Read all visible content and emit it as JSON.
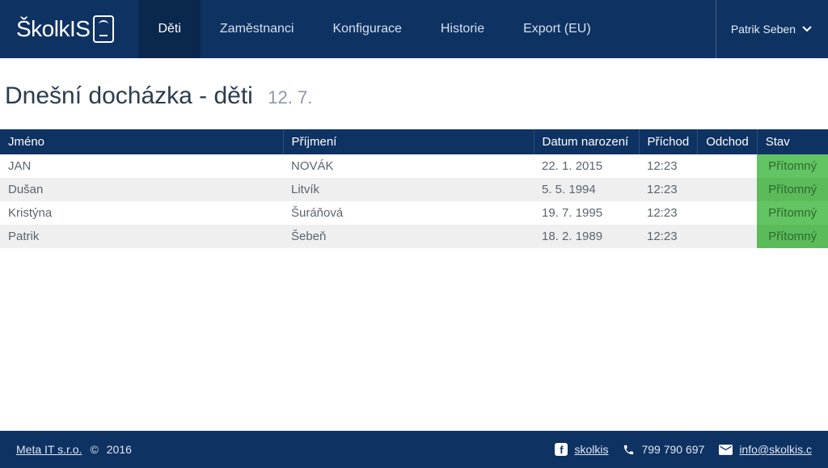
{
  "brand": {
    "name": "ŠkolkIS"
  },
  "nav": {
    "items": [
      "Děti",
      "Zaměstnanci",
      "Konfigurace",
      "Historie",
      "Export (EU)"
    ],
    "active_index": 0
  },
  "user": {
    "name": "Patrik Seben"
  },
  "page": {
    "title": "Dnešní docházka - děti",
    "date": "12. 7."
  },
  "table": {
    "columns": [
      "Jméno",
      "Příjmení",
      "Datum narození",
      "Příchod",
      "Odchod",
      "Stav"
    ],
    "rows": [
      {
        "jmeno": "JAN",
        "prijmeni": "NOVÁK",
        "datum": "22. 1. 2015",
        "prichod": "12:23",
        "odchod": "",
        "stav": "Přítomný"
      },
      {
        "jmeno": "Dušan",
        "prijmeni": "Litvík",
        "datum": "5. 5. 1994",
        "prichod": "12:23",
        "odchod": "",
        "stav": "Přítomný"
      },
      {
        "jmeno": "Kristýna",
        "prijmeni": "Šuráňová",
        "datum": "19. 7. 1995",
        "prichod": "12:23",
        "odchod": "",
        "stav": "Přítomný"
      },
      {
        "jmeno": "Patrik",
        "prijmeni": "Šebeň",
        "datum": "18. 2. 1989",
        "prichod": "12:23",
        "odchod": "",
        "stav": "Přítomný"
      }
    ]
  },
  "footer": {
    "company": "Meta IT s.r.o.",
    "copyright_symbol": "©",
    "year": "2016",
    "social_label": "skolkis",
    "phone": "799 790 697",
    "email": "info@skolkis.c"
  }
}
